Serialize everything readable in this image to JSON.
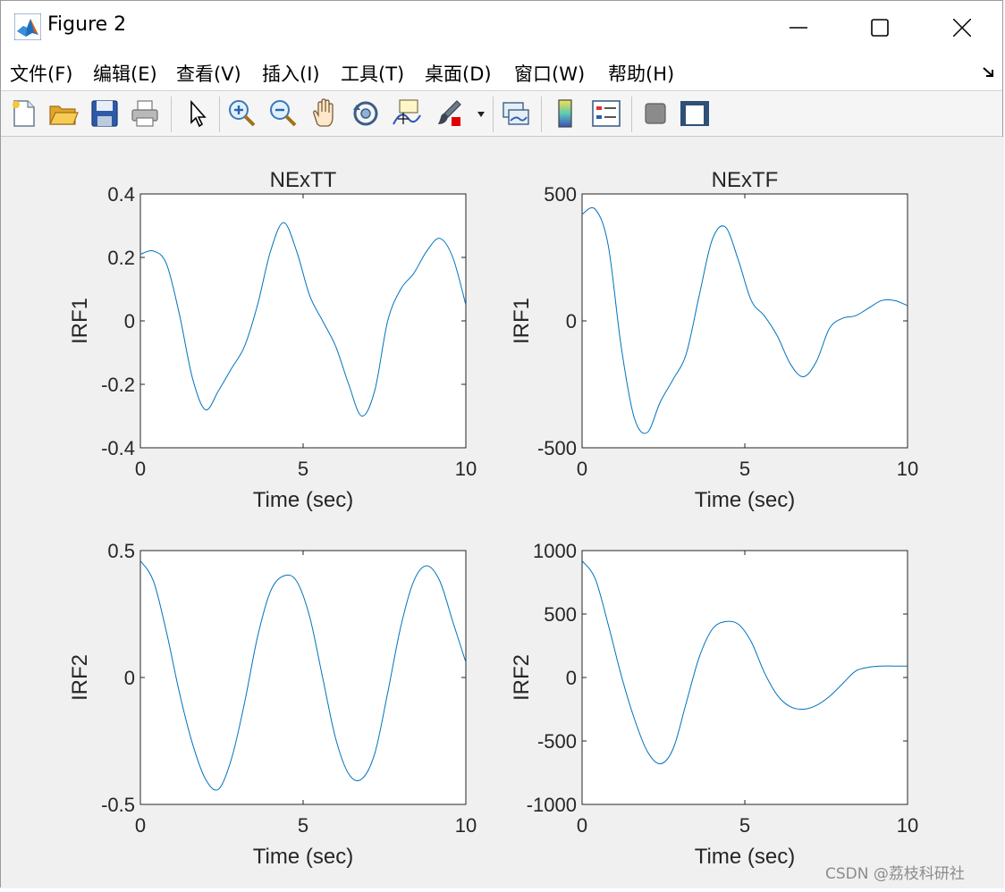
{
  "window": {
    "title": "Figure 2"
  },
  "menu": {
    "items": [
      {
        "label": "文件(F)"
      },
      {
        "label": "编辑(E)"
      },
      {
        "label": "查看(V)"
      },
      {
        "label": "插入(I)"
      },
      {
        "label": "工具(T)"
      },
      {
        "label": "桌面(D)"
      },
      {
        "label": "窗口(W)"
      },
      {
        "label": "帮助(H)"
      }
    ]
  },
  "toolbar": {
    "icons": [
      "new-file-icon",
      "open-folder-icon",
      "save-icon",
      "print-icon",
      "pointer-icon",
      "zoom-in-icon",
      "zoom-out-icon",
      "pan-hand-icon",
      "rotate-3d-icon",
      "data-cursor-icon",
      "brush-icon",
      "link-plot-icon",
      "colorbar-icon",
      "legend-icon",
      "hide-plot-tools-icon",
      "show-plot-tools-icon"
    ]
  },
  "colors": {
    "line": "#0072BD",
    "axes_bg": "#ffffff",
    "figure_bg": "#f0f0f0",
    "axis_text": "#262626"
  },
  "watermark": "CSDN @荔枝科研社",
  "chart_data": [
    {
      "type": "line",
      "title": "NExTT",
      "xlabel": "Time (sec)",
      "ylabel": "IRF1",
      "xlim": [
        0,
        10
      ],
      "ylim": [
        -0.4,
        0.4
      ],
      "xticks": [
        0,
        5,
        10
      ],
      "yticks": [
        -0.4,
        -0.2,
        0,
        0.2,
        0.4
      ],
      "ytick_labels": [
        "-0.4",
        "-0.2",
        "0",
        "0.2",
        "0.4"
      ],
      "x": [
        0,
        0.4,
        0.8,
        1.2,
        1.6,
        2.0,
        2.4,
        2.8,
        3.2,
        3.6,
        4.0,
        4.4,
        4.8,
        5.2,
        5.6,
        6.0,
        6.4,
        6.8,
        7.2,
        7.6,
        8.0,
        8.4,
        8.8,
        9.2,
        9.6,
        10.0
      ],
      "y": [
        0.21,
        0.22,
        0.18,
        0.02,
        -0.18,
        -0.28,
        -0.22,
        -0.15,
        -0.08,
        0.05,
        0.22,
        0.31,
        0.22,
        0.08,
        0.0,
        -0.08,
        -0.2,
        -0.3,
        -0.22,
        0.0,
        0.1,
        0.15,
        0.22,
        0.26,
        0.2,
        0.05
      ]
    },
    {
      "type": "line",
      "title": "NExTF",
      "xlabel": "Time (sec)",
      "ylabel": "IRF1",
      "xlim": [
        0,
        10
      ],
      "ylim": [
        -500,
        500
      ],
      "xticks": [
        0,
        5,
        10
      ],
      "yticks": [
        -500,
        0,
        500
      ],
      "ytick_labels": [
        "-500",
        "0",
        "500"
      ],
      "x": [
        0,
        0.4,
        0.8,
        1.2,
        1.6,
        2.0,
        2.4,
        2.8,
        3.2,
        3.6,
        4.0,
        4.4,
        4.8,
        5.2,
        5.6,
        6.0,
        6.4,
        6.8,
        7.2,
        7.6,
        8.0,
        8.4,
        8.8,
        9.2,
        9.6,
        10.0
      ],
      "y": [
        420,
        440,
        300,
        -100,
        -380,
        -440,
        -320,
        -230,
        -130,
        100,
        320,
        370,
        240,
        80,
        20,
        -60,
        -170,
        -220,
        -160,
        -30,
        10,
        20,
        50,
        80,
        80,
        60
      ]
    },
    {
      "type": "line",
      "title": "",
      "xlabel": "Time (sec)",
      "ylabel": "IRF2",
      "xlim": [
        0,
        10
      ],
      "ylim": [
        -0.5,
        0.5
      ],
      "xticks": [
        0,
        5,
        10
      ],
      "yticks": [
        -0.5,
        0,
        0.5
      ],
      "ytick_labels": [
        "-0.5",
        "0",
        "0.5"
      ],
      "x": [
        0,
        0.4,
        0.8,
        1.2,
        1.6,
        2.0,
        2.4,
        2.8,
        3.2,
        3.6,
        4.0,
        4.4,
        4.8,
        5.2,
        5.6,
        6.0,
        6.4,
        6.8,
        7.2,
        7.6,
        8.0,
        8.4,
        8.8,
        9.2,
        9.6,
        10.0
      ],
      "y": [
        0.46,
        0.38,
        0.18,
        -0.06,
        -0.26,
        -0.4,
        -0.44,
        -0.32,
        -0.1,
        0.16,
        0.34,
        0.4,
        0.38,
        0.24,
        0.0,
        -0.24,
        -0.38,
        -0.4,
        -0.3,
        -0.06,
        0.2,
        0.38,
        0.44,
        0.38,
        0.22,
        0.06
      ]
    },
    {
      "type": "line",
      "title": "",
      "xlabel": "Time (sec)",
      "ylabel": "IRF2",
      "xlim": [
        0,
        10
      ],
      "ylim": [
        -1000,
        1000
      ],
      "xticks": [
        0,
        5,
        10
      ],
      "yticks": [
        -1000,
        -500,
        0,
        500,
        1000
      ],
      "ytick_labels": [
        "-1000",
        "-500",
        "0",
        "500",
        "1000"
      ],
      "x": [
        0,
        0.4,
        0.8,
        1.2,
        1.6,
        2.0,
        2.4,
        2.8,
        3.2,
        3.6,
        4.0,
        4.4,
        4.8,
        5.2,
        5.6,
        6.0,
        6.4,
        6.8,
        7.2,
        7.6,
        8.0,
        8.4,
        8.8,
        9.2,
        9.6,
        10.0
      ],
      "y": [
        920,
        780,
        420,
        20,
        -320,
        -580,
        -680,
        -560,
        -200,
        160,
        380,
        440,
        420,
        280,
        40,
        -140,
        -230,
        -250,
        -220,
        -150,
        -50,
        50,
        80,
        90,
        90,
        90
      ]
    }
  ]
}
